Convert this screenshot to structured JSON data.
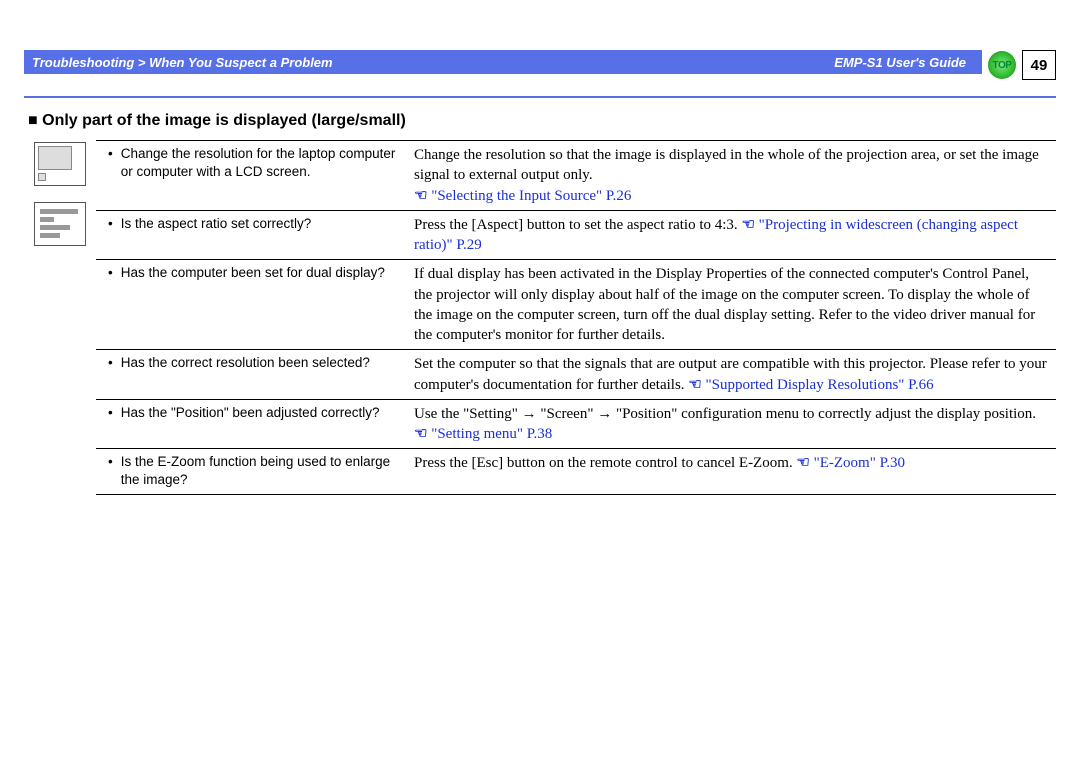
{
  "header": {
    "breadcrumb": "Troubleshooting > When You Suspect a Problem",
    "guide": "EMP-S1 User's Guide",
    "top_label": "TOP",
    "page_number": "49"
  },
  "section": {
    "title": "Only part of the image is displayed (large/small)"
  },
  "rows": [
    {
      "q": "Change the resolution for the laptop computer or computer with a LCD screen.",
      "a_pre": "Change the resolution so that the image is displayed in the whole of the projection area, or set the image signal to external output only.",
      "a_link": "\"Selecting the Input Source\" P.26"
    },
    {
      "q": "Is the aspect ratio set correctly?",
      "a_pre": "Press the [Aspect] button to set the aspect ratio to 4:3.",
      "a_link": "\"Projecting in widescreen (changing aspect ratio)\" P.29"
    },
    {
      "q": "Has the computer been set for dual display?",
      "a_pre": "If dual display has been activated in the Display Properties of the connected computer's Control Panel, the projector will only display about half of the image on the computer screen. To display the whole of the image on the computer screen, turn off the dual display setting. Refer to the video driver manual for the computer's monitor for further details.",
      "a_link": ""
    },
    {
      "q": "Has the correct resolution been selected?",
      "a_pre": "Set the computer so that the signals that are output are compatible with this projector. Please refer to your computer's documentation for further details.",
      "a_link": "\"Supported Display Resolutions\" P.66"
    },
    {
      "q": "Has the \"Position\" been adjusted correctly?",
      "a_pre": "Use the \"Setting\" → \"Screen\" → \"Position\" configuration menu to correctly adjust the display position.",
      "a_link": "\"Setting menu\" P.38"
    },
    {
      "q": "Is the E-Zoom function being used to enlarge the image?",
      "a_pre": "Press the [Esc] button on the remote control to cancel E-Zoom.",
      "a_link": "\"E-Zoom\" P.30"
    }
  ]
}
